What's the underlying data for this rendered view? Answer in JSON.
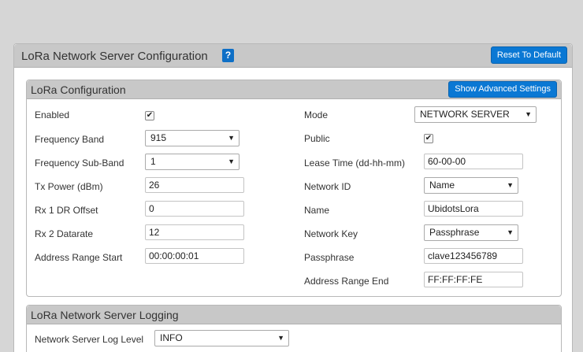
{
  "header": {
    "title": "LoRa Network Server Configuration",
    "help": "?",
    "reset_label": "Reset To Default"
  },
  "config": {
    "title": "LoRa Configuration",
    "advanced_label": "Show Advanced Settings",
    "left": {
      "enabled_label": "Enabled",
      "enabled_checked": true,
      "freq_band_label": "Frequency Band",
      "freq_band_value": "915",
      "freq_subband_label": "Frequency Sub-Band",
      "freq_subband_value": "1",
      "tx_power_label": "Tx Power (dBm)",
      "tx_power_value": "26",
      "rx1_label": "Rx 1 DR Offset",
      "rx1_value": "0",
      "rx2_label": "Rx 2 Datarate",
      "rx2_value": "12",
      "addr_start_label": "Address Range Start",
      "addr_start_value": "00:00:00:01"
    },
    "right": {
      "mode_label": "Mode",
      "mode_value": "NETWORK SERVER",
      "public_label": "Public",
      "public_checked": true,
      "lease_label": "Lease Time (dd-hh-mm)",
      "lease_value": "60-00-00",
      "netid_label": "Network ID",
      "netid_value": "Name",
      "name_label": "Name",
      "name_value": "UbidotsLora",
      "netkey_label": "Network Key",
      "netkey_value": "Passphrase",
      "pass_label": "Passphrase",
      "pass_value": "clave123456789",
      "addr_end_label": "Address Range End",
      "addr_end_value": "FF:FF:FF:FE"
    }
  },
  "logging": {
    "title": "LoRa Network Server Logging",
    "level_label": "Network Server Log Level",
    "level_value": "INFO"
  },
  "icons": {
    "checkbox": "checkmark-icon",
    "dropdown": "triangle-down-icon"
  }
}
